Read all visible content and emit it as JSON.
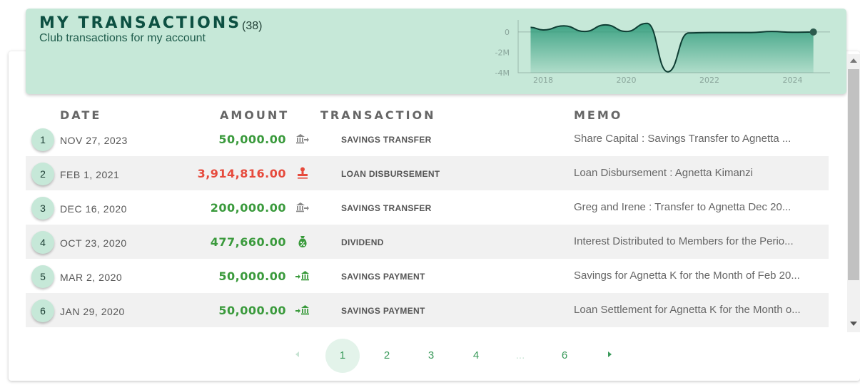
{
  "header": {
    "title": "MY TRANSACTIONS",
    "count": "(38)",
    "subtitle": "Club transactions for my account"
  },
  "chart_data": {
    "type": "area",
    "x": [
      2017.7,
      2018.0,
      2018.5,
      2019.0,
      2019.5,
      2020.0,
      2020.5,
      2021.0,
      2021.5,
      2022.0,
      2022.5,
      2023.0,
      2023.5,
      2024.0,
      2024.5
    ],
    "y": [
      0.45,
      0.2,
      0.6,
      0.05,
      0.7,
      0.05,
      0.85,
      -3.91,
      -0.1,
      -0.05,
      -0.05,
      -0.05,
      0.05,
      -0.03,
      0.0
    ],
    "ylim": [
      -4,
      0.9
    ],
    "yticks": [
      "0",
      "-2M",
      "-4M"
    ],
    "yticks_values": [
      0,
      -2,
      -4
    ],
    "xticks": [
      "2018",
      "2020",
      "2022",
      "2024"
    ],
    "xticks_values": [
      2018,
      2020,
      2022,
      2024
    ],
    "xlim": [
      2017.4,
      2024.9
    ],
    "unit": "M",
    "fill_color": "#2e9b7a",
    "line_color": "#0e3d33"
  },
  "columns": {
    "date": "DATE",
    "amount": "AMOUNT",
    "transaction": "TRANSACTION",
    "memo": "MEMO"
  },
  "rows": [
    {
      "index": "1",
      "date": "NOV 27, 2023",
      "amount": "50,000.00",
      "sign": "pos",
      "icon": "bank-transfer-icon",
      "type": "SAVINGS TRANSFER",
      "memo": "Share Capital : Savings Transfer to Agnetta ..."
    },
    {
      "index": "2",
      "date": "FEB 1, 2021",
      "amount": "3,914,816.00",
      "sign": "neg",
      "icon": "stamp-icon",
      "type": "LOAN DISBURSEMENT",
      "memo": "Loan Disbursement : Agnetta Kimanzi"
    },
    {
      "index": "3",
      "date": "DEC 16, 2020",
      "amount": "200,000.00",
      "sign": "pos",
      "icon": "bank-transfer-icon",
      "type": "SAVINGS TRANSFER",
      "memo": "Greg and Irene : Transfer to Agnetta Dec 20..."
    },
    {
      "index": "4",
      "date": "OCT 23, 2020",
      "amount": "477,660.00",
      "sign": "pos",
      "icon": "money-bag-percent-icon",
      "type": "DIVIDEND",
      "memo": "Interest Distributed to Members for the Perio..."
    },
    {
      "index": "5",
      "date": "MAR 2, 2020",
      "amount": "50,000.00",
      "sign": "pos",
      "icon": "bank-deposit-icon",
      "type": "SAVINGS PAYMENT",
      "memo": "Savings for Agnetta K for the Month of Feb 20..."
    },
    {
      "index": "6",
      "date": "JAN 29, 2020",
      "amount": "50,000.00",
      "sign": "pos",
      "icon": "bank-deposit-icon",
      "type": "SAVINGS PAYMENT",
      "memo": "Loan Settlement for Agnetta K for the Month o..."
    }
  ],
  "pagination": {
    "pages": [
      "1",
      "2",
      "3",
      "4",
      "...",
      "6"
    ],
    "current": "1"
  },
  "colors": {
    "accent": "#c6e8d8",
    "positive": "#3a9a3c",
    "negative": "#e64a3c",
    "title": "#0d5042"
  }
}
